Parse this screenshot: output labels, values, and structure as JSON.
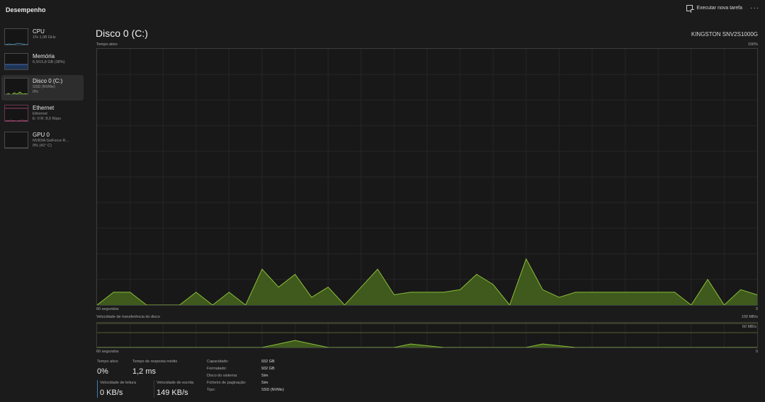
{
  "header": {
    "title": "Desempenho",
    "run_task_label": "Executar nova tarefa",
    "more_label": "···"
  },
  "sidebar": {
    "items": [
      {
        "name": "CPU",
        "sub1": "1% 1,08 GHz",
        "sub2": "",
        "sub3": "",
        "color": "#4aa3d8",
        "active": false
      },
      {
        "name": "Memória",
        "sub1": "6,0/15,8 GB (38%)",
        "sub2": "",
        "sub3": "",
        "color": "#5a8ad8",
        "active": false
      },
      {
        "name": "Disco 0 (C:)",
        "sub1": "SSD (NVMe)",
        "sub2": "0%",
        "sub3": "",
        "color": "#8bbf3a",
        "active": true
      },
      {
        "name": "Ethernet",
        "sub1": "Ethernet",
        "sub2": "E: 0 R: 8,0 Kbps",
        "sub3": "",
        "color": "#c05a86",
        "active": false
      },
      {
        "name": "GPU 0",
        "sub1": "NVIDIA GeForce R...",
        "sub2": "0% (41° C)",
        "sub3": "",
        "color": "#8a8a8a",
        "active": false
      }
    ]
  },
  "main": {
    "title": "Disco 0 (C:)",
    "model": "KINGSTON SNV2S1000G",
    "graph1": {
      "label": "Tempo ativo",
      "max": "100%",
      "time_label": "60 segundos",
      "min": "0",
      "color": "#8bbf3a",
      "fill": "#3f5a1c",
      "chart_data": {
        "type": "area",
        "x_seconds_ago": [
          60,
          58.5,
          57,
          55.5,
          54,
          52.5,
          51,
          49.5,
          48,
          46.5,
          45,
          43.5,
          42,
          40.5,
          39,
          37.5,
          36,
          34.5,
          33,
          31.5,
          30,
          28.5,
          27,
          25.5,
          24,
          22.5,
          21,
          19.5,
          18,
          16.5,
          15,
          13.5,
          12,
          10.5,
          9,
          7.5,
          6,
          4.5,
          3,
          1.5,
          0
        ],
        "values": [
          0,
          5,
          5,
          0,
          0,
          0,
          5,
          0,
          5,
          0,
          14,
          7,
          12,
          3,
          7,
          0,
          7,
          14,
          4,
          5,
          5,
          5,
          6,
          12,
          8,
          0,
          18,
          6,
          3,
          5,
          5,
          5,
          5,
          5,
          5,
          5,
          0,
          10,
          0,
          6,
          4
        ]
      }
    },
    "graph2": {
      "label": "Velocidade de transferência do disco",
      "max": "100 MB/s",
      "marker": "60 MB/s",
      "time_label": "60 segundos",
      "min": "0",
      "color": "#8bbf3a",
      "fill": "#3f5a1c",
      "chart_data": {
        "type": "area",
        "marker_value_mbs": 60,
        "max_value_mbs": 100,
        "values": [
          0,
          0,
          0,
          0,
          0,
          0,
          0,
          0,
          0,
          0,
          0,
          2,
          4,
          2,
          0,
          0,
          0,
          0,
          0,
          2,
          1,
          0,
          0,
          0,
          0,
          0,
          0,
          2,
          1,
          0,
          0,
          0,
          0,
          0,
          0,
          0,
          0,
          0,
          0,
          0,
          0
        ]
      }
    }
  },
  "stats": {
    "active_time_label": "Tempo ativo",
    "active_time_value": "0%",
    "response_label": "Tempo de resposta médio",
    "response_value": "1,2 ms",
    "read_label": "Velocidade de leitura",
    "read_value": "0 KB/s",
    "write_label": "Velocidade de escrita",
    "write_value": "149 KB/s"
  },
  "properties": [
    {
      "key": "Capacidade:",
      "value": "932 GB"
    },
    {
      "key": "Formatado:",
      "value": "932 GB"
    },
    {
      "key": "Disco do sistema:",
      "value": "Sim"
    },
    {
      "key": "Ficheiro de paginação:",
      "value": "Sim"
    },
    {
      "key": "Tipo:",
      "value": "SSD (NVMe)"
    }
  ]
}
